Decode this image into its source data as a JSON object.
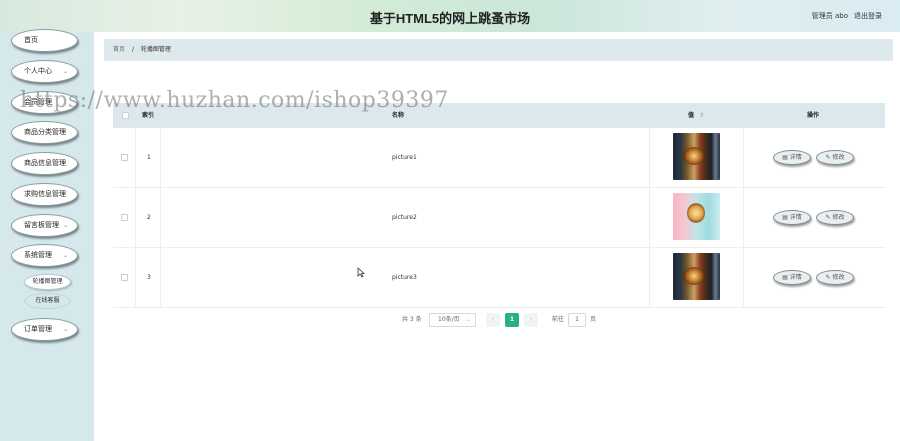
{
  "header": {
    "title": "基于HTML5的网上跳蚤市场",
    "user": "管理员 abo",
    "logout": "退出登录"
  },
  "sidebar": {
    "items": [
      {
        "label": "首页"
      },
      {
        "label": "个人中心",
        "chevron": "⌄"
      },
      {
        "label": "会员管理"
      },
      {
        "label": "商品分类管理"
      },
      {
        "label": "商品信息管理"
      },
      {
        "label": "求购信息管理"
      },
      {
        "label": "留言板管理",
        "chevron": "⌄"
      },
      {
        "label": "系统管理",
        "chevron": "⌄"
      },
      {
        "label": "订单管理",
        "chevron": "⌄"
      }
    ],
    "sub_items": [
      {
        "label": "轮播图管理"
      },
      {
        "label": "在线客服"
      }
    ]
  },
  "breadcrumb": {
    "home": "首页",
    "sep": "/",
    "current": "轮播图管理"
  },
  "table": {
    "headers": {
      "index": "索引",
      "name": "名称",
      "value": "值",
      "sort": "⇕",
      "ops": "操作"
    },
    "rows": [
      {
        "index": "1",
        "name": "picture1",
        "image": "food-dark"
      },
      {
        "index": "2",
        "name": "picture2",
        "image": "food-pink"
      },
      {
        "index": "3",
        "name": "picture3",
        "image": "food-dark"
      }
    ],
    "detail_label": "▤ 详情",
    "edit_label": "✎ 修改"
  },
  "pagination": {
    "total": "共 3 条",
    "page_size": "10条/页",
    "page_size_arrow": "⌄",
    "prev": "‹",
    "current": "1",
    "next": "›",
    "goto_label": "前往",
    "goto_value": "1",
    "goto_suffix": "页"
  },
  "watermark": "https://www.huzhan.com/ishop39397",
  "colors": {
    "accent": "#25b27c",
    "sidebar_bg": "#d5e8ec",
    "table_header_bg": "#dce8ec"
  }
}
